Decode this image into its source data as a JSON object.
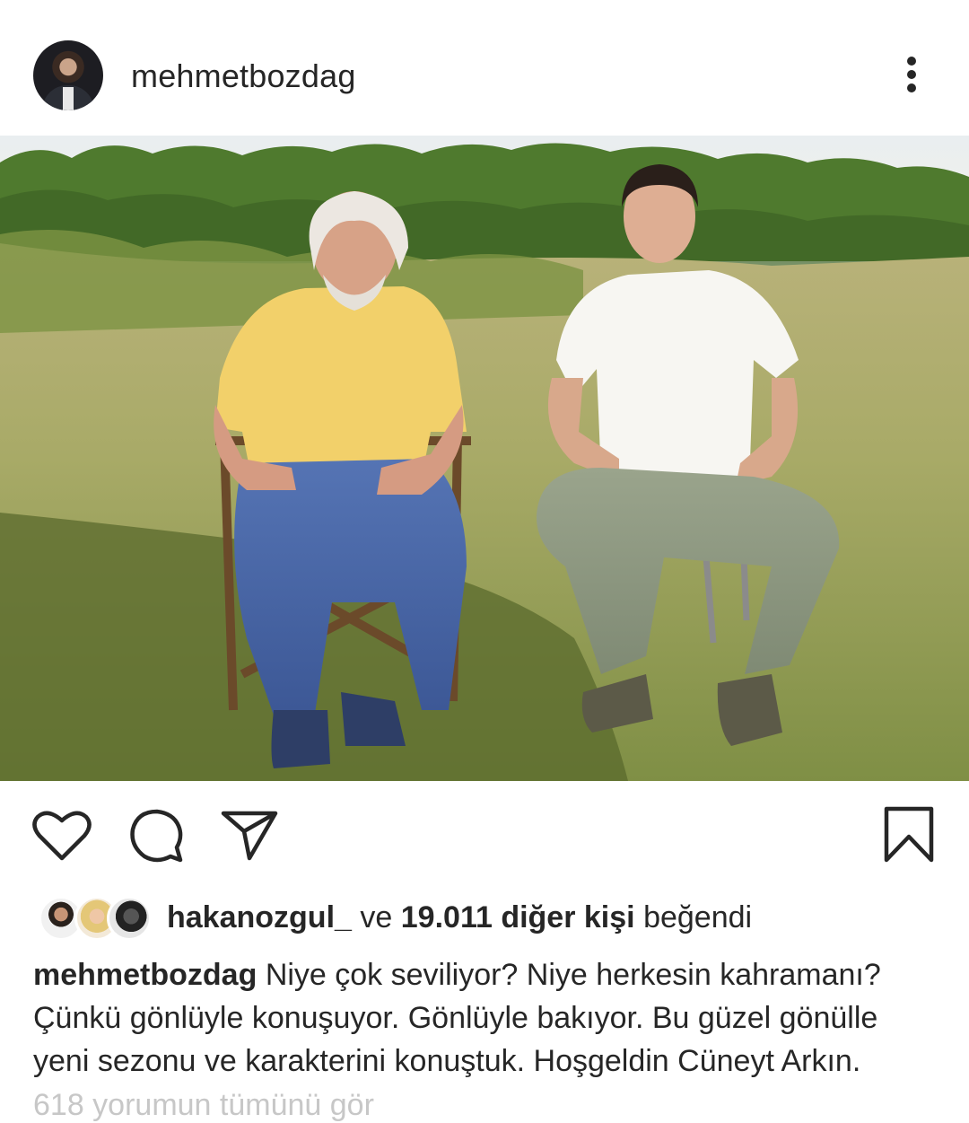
{
  "post": {
    "username": "mehmetbozdag",
    "menu_icon": "more-vertical-icon",
    "liked_by": {
      "user": "hakanozgul_",
      "connector": "ve",
      "others": "19.011 diğer kişi",
      "suffix": "beğendi"
    },
    "caption": {
      "username": "mehmetbozdag",
      "text": "Niye çok seviliyor? Niye herkesin kahramanı? Çünkü gönlüyle konuşuyor. Gönlüyle bakıyor. Bu güzel gönülle yeni sezonu ve karakterini konuştuk. Hoşgeldin Cüneyt Arkın."
    },
    "truncated_line": "618 yorumun tümünü gör"
  },
  "actions": {
    "like_icon": "heart-icon",
    "comment_icon": "comment-icon",
    "share_icon": "send-icon",
    "save_icon": "bookmark-icon"
  }
}
